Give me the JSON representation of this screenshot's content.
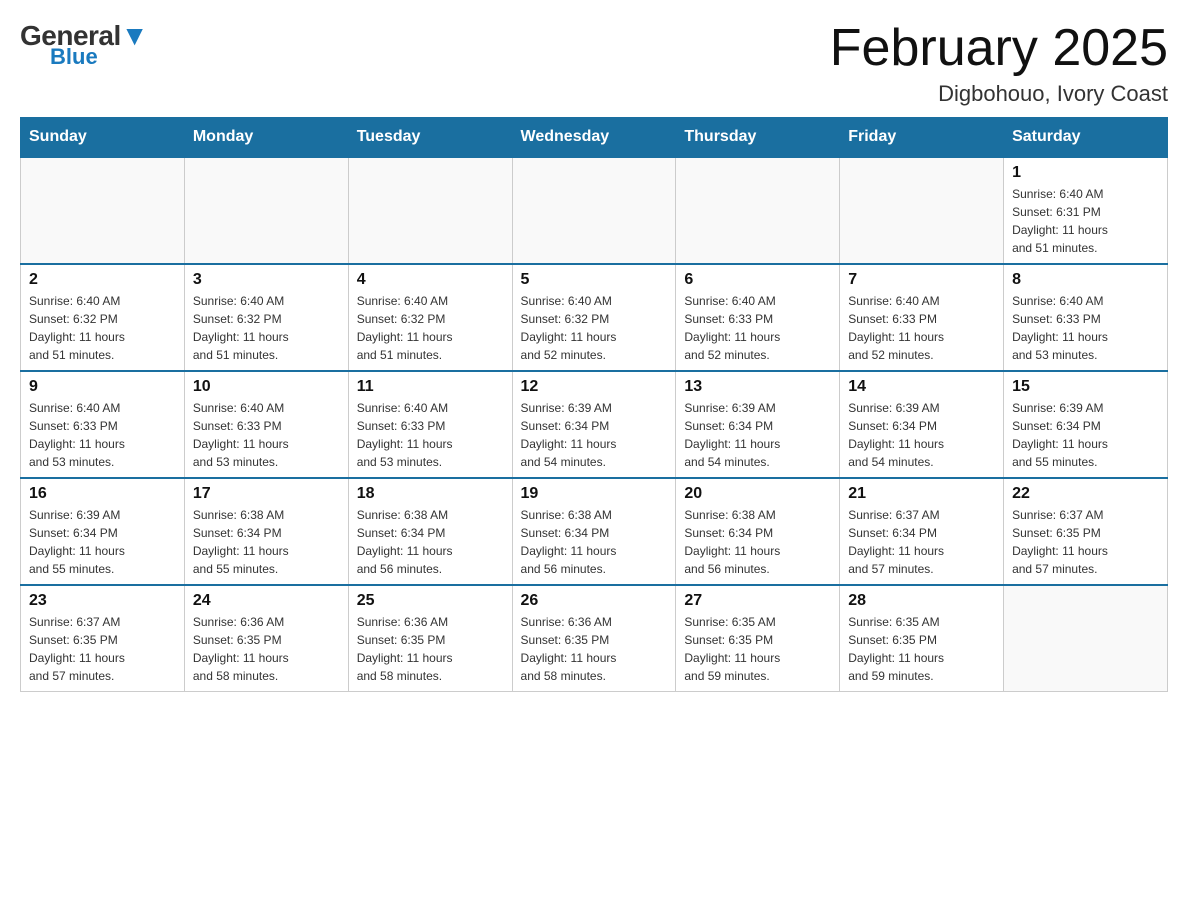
{
  "header": {
    "logo_general": "General",
    "logo_blue": "Blue",
    "month_title": "February 2025",
    "location": "Digbohouo, Ivory Coast"
  },
  "weekdays": [
    "Sunday",
    "Monday",
    "Tuesday",
    "Wednesday",
    "Thursday",
    "Friday",
    "Saturday"
  ],
  "weeks": [
    [
      {
        "day": "",
        "info": ""
      },
      {
        "day": "",
        "info": ""
      },
      {
        "day": "",
        "info": ""
      },
      {
        "day": "",
        "info": ""
      },
      {
        "day": "",
        "info": ""
      },
      {
        "day": "",
        "info": ""
      },
      {
        "day": "1",
        "info": "Sunrise: 6:40 AM\nSunset: 6:31 PM\nDaylight: 11 hours\nand 51 minutes."
      }
    ],
    [
      {
        "day": "2",
        "info": "Sunrise: 6:40 AM\nSunset: 6:32 PM\nDaylight: 11 hours\nand 51 minutes."
      },
      {
        "day": "3",
        "info": "Sunrise: 6:40 AM\nSunset: 6:32 PM\nDaylight: 11 hours\nand 51 minutes."
      },
      {
        "day": "4",
        "info": "Sunrise: 6:40 AM\nSunset: 6:32 PM\nDaylight: 11 hours\nand 51 minutes."
      },
      {
        "day": "5",
        "info": "Sunrise: 6:40 AM\nSunset: 6:32 PM\nDaylight: 11 hours\nand 52 minutes."
      },
      {
        "day": "6",
        "info": "Sunrise: 6:40 AM\nSunset: 6:33 PM\nDaylight: 11 hours\nand 52 minutes."
      },
      {
        "day": "7",
        "info": "Sunrise: 6:40 AM\nSunset: 6:33 PM\nDaylight: 11 hours\nand 52 minutes."
      },
      {
        "day": "8",
        "info": "Sunrise: 6:40 AM\nSunset: 6:33 PM\nDaylight: 11 hours\nand 53 minutes."
      }
    ],
    [
      {
        "day": "9",
        "info": "Sunrise: 6:40 AM\nSunset: 6:33 PM\nDaylight: 11 hours\nand 53 minutes."
      },
      {
        "day": "10",
        "info": "Sunrise: 6:40 AM\nSunset: 6:33 PM\nDaylight: 11 hours\nand 53 minutes."
      },
      {
        "day": "11",
        "info": "Sunrise: 6:40 AM\nSunset: 6:33 PM\nDaylight: 11 hours\nand 53 minutes."
      },
      {
        "day": "12",
        "info": "Sunrise: 6:39 AM\nSunset: 6:34 PM\nDaylight: 11 hours\nand 54 minutes."
      },
      {
        "day": "13",
        "info": "Sunrise: 6:39 AM\nSunset: 6:34 PM\nDaylight: 11 hours\nand 54 minutes."
      },
      {
        "day": "14",
        "info": "Sunrise: 6:39 AM\nSunset: 6:34 PM\nDaylight: 11 hours\nand 54 minutes."
      },
      {
        "day": "15",
        "info": "Sunrise: 6:39 AM\nSunset: 6:34 PM\nDaylight: 11 hours\nand 55 minutes."
      }
    ],
    [
      {
        "day": "16",
        "info": "Sunrise: 6:39 AM\nSunset: 6:34 PM\nDaylight: 11 hours\nand 55 minutes."
      },
      {
        "day": "17",
        "info": "Sunrise: 6:38 AM\nSunset: 6:34 PM\nDaylight: 11 hours\nand 55 minutes."
      },
      {
        "day": "18",
        "info": "Sunrise: 6:38 AM\nSunset: 6:34 PM\nDaylight: 11 hours\nand 56 minutes."
      },
      {
        "day": "19",
        "info": "Sunrise: 6:38 AM\nSunset: 6:34 PM\nDaylight: 11 hours\nand 56 minutes."
      },
      {
        "day": "20",
        "info": "Sunrise: 6:38 AM\nSunset: 6:34 PM\nDaylight: 11 hours\nand 56 minutes."
      },
      {
        "day": "21",
        "info": "Sunrise: 6:37 AM\nSunset: 6:34 PM\nDaylight: 11 hours\nand 57 minutes."
      },
      {
        "day": "22",
        "info": "Sunrise: 6:37 AM\nSunset: 6:35 PM\nDaylight: 11 hours\nand 57 minutes."
      }
    ],
    [
      {
        "day": "23",
        "info": "Sunrise: 6:37 AM\nSunset: 6:35 PM\nDaylight: 11 hours\nand 57 minutes."
      },
      {
        "day": "24",
        "info": "Sunrise: 6:36 AM\nSunset: 6:35 PM\nDaylight: 11 hours\nand 58 minutes."
      },
      {
        "day": "25",
        "info": "Sunrise: 6:36 AM\nSunset: 6:35 PM\nDaylight: 11 hours\nand 58 minutes."
      },
      {
        "day": "26",
        "info": "Sunrise: 6:36 AM\nSunset: 6:35 PM\nDaylight: 11 hours\nand 58 minutes."
      },
      {
        "day": "27",
        "info": "Sunrise: 6:35 AM\nSunset: 6:35 PM\nDaylight: 11 hours\nand 59 minutes."
      },
      {
        "day": "28",
        "info": "Sunrise: 6:35 AM\nSunset: 6:35 PM\nDaylight: 11 hours\nand 59 minutes."
      },
      {
        "day": "",
        "info": ""
      }
    ]
  ]
}
